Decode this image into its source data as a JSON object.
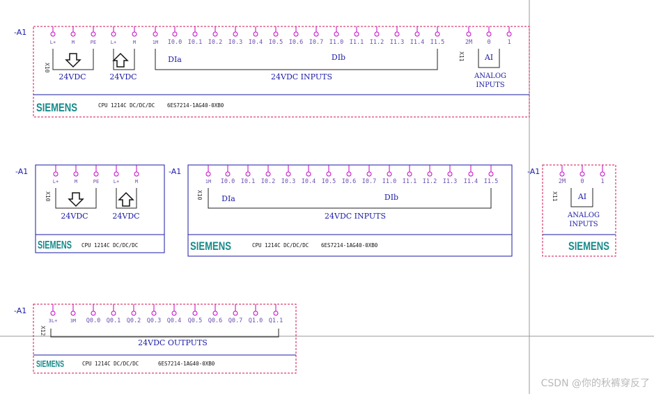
{
  "modules": [
    {
      "id": "m1",
      "ref": "-A1",
      "frame_color": "#d0104c",
      "frame_style": "dashed",
      "terminals": [
        "L+",
        "M",
        "PE",
        "L+",
        "M",
        "1M",
        "I0.0",
        "I0.1",
        "I0.2",
        "I0.3",
        "I0.4",
        "I0.5",
        "I0.6",
        "I0.7",
        "I1.0",
        "I1.1",
        "I1.2",
        "I1.3",
        "I1.4",
        "I1.5",
        "2M",
        "0",
        "1"
      ],
      "connector_ids": [
        "X10",
        "X11"
      ],
      "labels": {
        "power_out": "24VDC",
        "power_in": "24VDC",
        "dia": "DIa",
        "dib": "DIb",
        "inputs": "24VDC INPUTS",
        "ai": "AI",
        "analog_1": "ANALOG",
        "analog_2": "INPUTS"
      },
      "brand": "SIEMENS",
      "cpu": "CPU 1214C DC/DC/DC",
      "part": "6ES7214-1AG40-0XB0"
    },
    {
      "id": "m2",
      "ref": "-A1",
      "frame_color": "#1a1aa6",
      "frame_style": "solid",
      "terminals": [
        "L+",
        "M",
        "PE",
        "L+",
        "M"
      ],
      "connector_ids": [
        "X10"
      ],
      "labels": {
        "power_out": "24VDC",
        "power_in": "24VDC"
      },
      "brand": "SIEMENS",
      "cpu": "CPU 1214C DC/DC/DC"
    },
    {
      "id": "m3",
      "ref": "-A1",
      "frame_color": "#1a1aa6",
      "frame_style": "solid",
      "terminals": [
        "1M",
        "I0.0",
        "I0.1",
        "I0.2",
        "I0.3",
        "I0.4",
        "I0.5",
        "I0.6",
        "I0.7",
        "I1.0",
        "I1.1",
        "I1.2",
        "I1.3",
        "I1.4",
        "I1.5"
      ],
      "connector_ids": [
        "X10"
      ],
      "labels": {
        "dia": "DIa",
        "dib": "DIb",
        "inputs": "24VDC INPUTS"
      },
      "brand": "SIEMENS",
      "cpu": "CPU 1214C DC/DC/DC",
      "part": "6ES7214-1AG40-0XB0"
    },
    {
      "id": "m4",
      "ref": "-A1",
      "frame_color": "#d0104c",
      "frame_style": "dashed",
      "terminals": [
        "2M",
        "0",
        "1"
      ],
      "connector_ids": [
        "X11"
      ],
      "labels": {
        "ai": "AI",
        "analog_1": "ANALOG",
        "analog_2": "INPUTS"
      },
      "brand": "SIEMENS"
    },
    {
      "id": "m5",
      "ref": "-A1",
      "frame_color": "#d0104c",
      "frame_style": "dashed",
      "terminals": [
        "3L+",
        "3M",
        "Q0.0",
        "Q0.1",
        "Q0.2",
        "Q0.3",
        "Q0.4",
        "Q0.5",
        "Q0.6",
        "Q0.7",
        "Q1.0",
        "Q1.1"
      ],
      "connector_ids": [
        "X12"
      ],
      "labels": {
        "outputs": "24VDC OUTPUTS"
      },
      "brand": "SIEMENS",
      "cpu": "CPU 1214C DC/DC/DC",
      "part": "6ES7214-1AG40-0XB0"
    }
  ],
  "colors": {
    "terminal": "#c400c4",
    "text": "#1a1aa6",
    "brand": "#168a8a",
    "guide": "#9a9a9a"
  },
  "watermark": "CSDN @你的秋裤穿反了"
}
